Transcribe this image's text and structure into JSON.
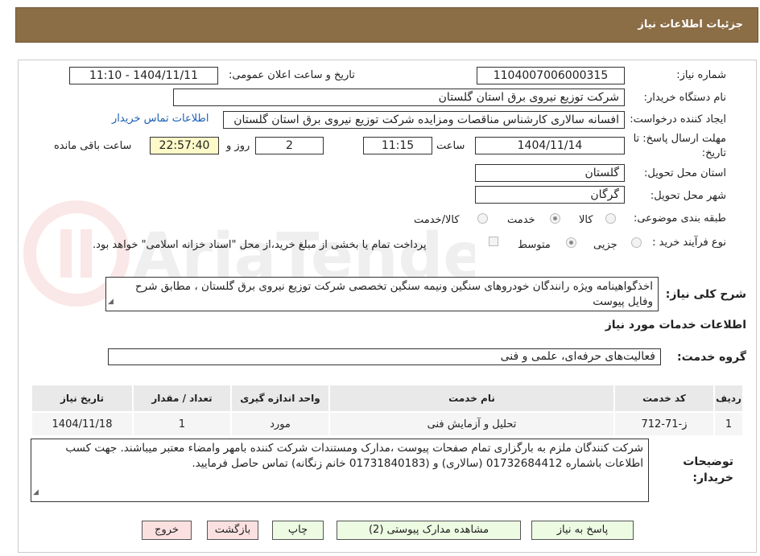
{
  "header": {
    "title": "جزئیات اطلاعات نیاز"
  },
  "form": {
    "need_number": {
      "label": "شماره نیاز:",
      "value": "1104007006000315"
    },
    "announce_datetime": {
      "label": "تاریخ و ساعت اعلان عمومی:",
      "value": "1404/11/11 - 11:10"
    },
    "buyer_org": {
      "label": "نام دستگاه خریدار:",
      "value": "شرکت توزیع نیروی برق استان گلستان"
    },
    "requester": {
      "label": "ایجاد کننده درخواست:",
      "value": "افسانه سالاری کارشناس مناقصات ومزایده شرکت توزیع نیروی برق استان گلستان",
      "contact_link": "اطلاعات تماس خریدار"
    },
    "deadline": {
      "label_line1": "مهلت ارسال پاسخ: تا",
      "label_line2": "تاریخ:",
      "date": "1404/11/14",
      "time_label": "ساعت",
      "time": "11:15",
      "days": "2",
      "days_label": "روز و",
      "remaining": "22:57:40",
      "remaining_label": "ساعت باقی مانده"
    },
    "delivery_province": {
      "label": "استان محل تحویل:",
      "value": "گلستان"
    },
    "delivery_city": {
      "label": "شهر محل تحویل:",
      "value": "گرگان"
    },
    "category": {
      "label": "طبقه بندی موضوعی:",
      "options": [
        "کالا",
        "خدمت",
        "کالا/خدمت"
      ],
      "selected": "خدمت"
    },
    "process_type": {
      "label": "نوع فرآیند خرید :",
      "options": [
        "جزیی",
        "متوسط"
      ],
      "selected": "متوسط",
      "payment_note": "پرداخت تمام یا بخشی از مبلغ خرید،از محل \"اسناد خزانه اسلامی\" خواهد بود."
    }
  },
  "description": {
    "label": "شرح کلی نیاز:",
    "text": "اخذگواهینامه ویژه رانندگان خودروهای سنگین ونیمه سنگین تخصصی   شرکت توزیع نیروی برق گلستان ، مطابق شرح وفایل پیوست"
  },
  "services": {
    "section_title": "اطلاعات خدمات مورد نیاز",
    "group_label": "گروه خدمت:",
    "group_value": "فعالیت‌های حرفه‌ای، علمی و فنی",
    "table": {
      "headers": [
        "ردیف",
        "کد خدمت",
        "نام خدمت",
        "واحد اندازه گیری",
        "تعداد / مقدار",
        "تاریخ نیاز"
      ],
      "rows": [
        [
          "1",
          "ز-71-712",
          "تحلیل و آزمایش فنی",
          "مورد",
          "1",
          "1404/11/18"
        ]
      ]
    }
  },
  "buyer_notes": {
    "label_line1": "توضیحات",
    "label_line2": "خریدار:",
    "text": "شرکت کنندگان ملزم به بارگزاری تمام صفحات پیوست ،مدارک ومستندات شرکت کننده بامهر وامضاء معتبر میباشند. جهت کسب اطلاعات باشماره 01732684412 (سالاری) و (01731840183 خانم زنگانه) تماس حاصل فرمایید."
  },
  "buttons": {
    "respond": "پاسخ به نیاز",
    "view_docs": "مشاهده مدارک پیوستی (2)",
    "print": "چاپ",
    "back": "بازگشت",
    "exit": "خروج"
  },
  "watermark": {
    "text": "AriaTender.neT"
  },
  "colors": {
    "header_bg": "#8b6d46",
    "link": "#1a5fb4",
    "remaining_bg": "#fdf9c9",
    "green_button": "#ecfbe2",
    "red_button": "#fbe0e0"
  }
}
